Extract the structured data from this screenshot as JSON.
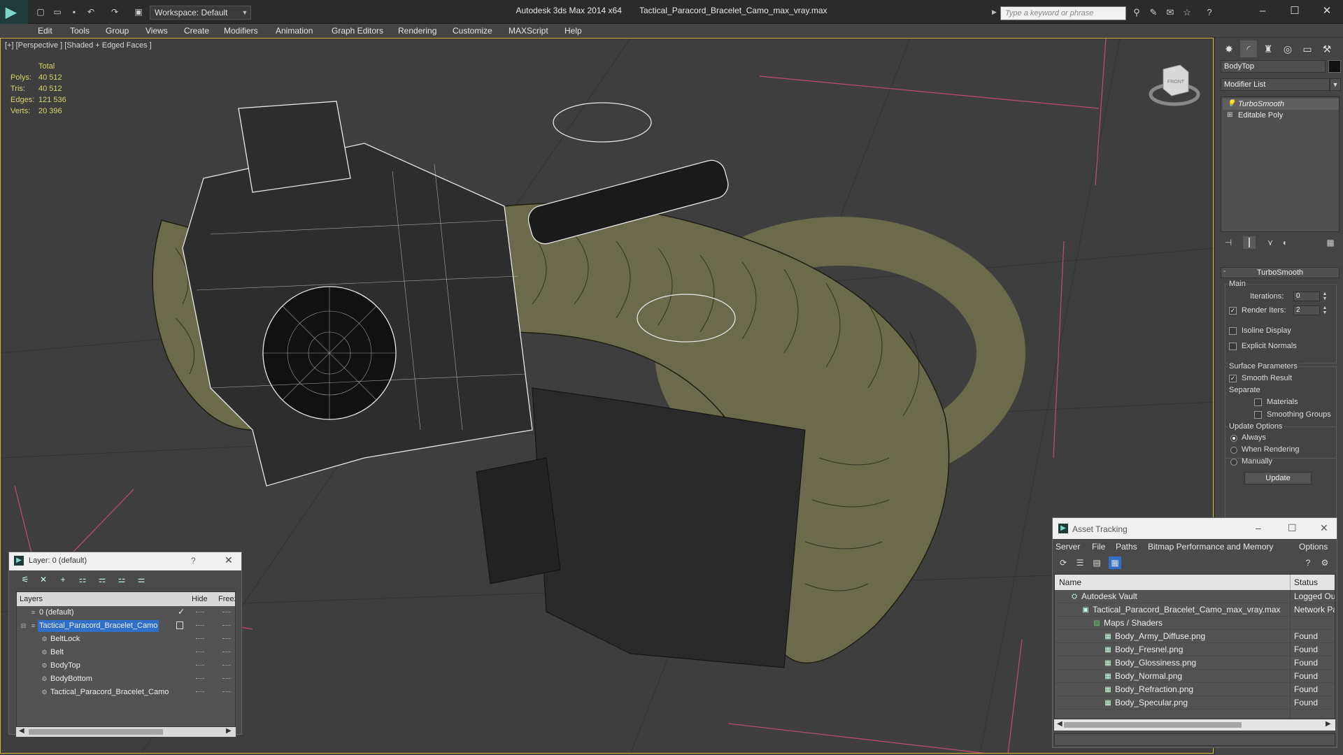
{
  "titlebar": {
    "workspace": "Workspace: Default",
    "app_name": "Autodesk 3ds Max  2014 x64",
    "file_name": "Tactical_Paracord_Bracelet_Camo_max_vray.max",
    "search_placeholder": "Type a keyword or phrase"
  },
  "menu": [
    "Edit",
    "Tools",
    "Group",
    "Views",
    "Create",
    "Modifiers",
    "Animation",
    "Graph Editors",
    "Rendering",
    "Customize",
    "MAXScript",
    "Help"
  ],
  "viewport": {
    "label": "[+] [Perspective ] [Shaded + Edged Faces ]",
    "stats": {
      "header": "Total",
      "rows": [
        {
          "key": "Polys:",
          "value": "40 512"
        },
        {
          "key": "Tris:",
          "value": "40 512"
        },
        {
          "key": "Edges:",
          "value": "121 536"
        },
        {
          "key": "Verts:",
          "value": "20 396"
        }
      ]
    },
    "viewcube_label": "FRONT"
  },
  "command_panel": {
    "object_name": "BodyTop",
    "modifier_list": "Modifier List",
    "stack": [
      "TurboSmooth",
      "Editable Poly"
    ],
    "rollout_title": "TurboSmooth",
    "main": {
      "label": "Main",
      "iterations_label": "Iterations:",
      "iterations_value": "0",
      "render_iters_label": "Render Iters:",
      "render_iters_value": "2",
      "render_iters_checked": true,
      "isoline_label": "Isoline Display",
      "explicit_label": "Explicit Normals"
    },
    "surface": {
      "label": "Surface Parameters",
      "smooth_result": "Smooth Result",
      "separate": "Separate",
      "materials": "Materials",
      "smoothing_groups": "Smoothing Groups"
    },
    "update": {
      "label": "Update Options",
      "always": "Always",
      "when_rendering": "When Rendering",
      "manually": "Manually",
      "button": "Update"
    }
  },
  "layer_window": {
    "title": "Layer: 0 (default)",
    "help": "?",
    "columns": {
      "layers": "Layers",
      "hide": "Hide",
      "freeze": "Freeze"
    },
    "rows": [
      {
        "name": "0 (default)",
        "level": 0,
        "active": true
      },
      {
        "name": "Tactical_Paracord_Bracelet_Camo",
        "level": 0,
        "selected": true
      },
      {
        "name": "BeltLock",
        "level": 1
      },
      {
        "name": "Belt",
        "level": 1
      },
      {
        "name": "BodyTop",
        "level": 1
      },
      {
        "name": "BodyBottom",
        "level": 1
      },
      {
        "name": "Tactical_Paracord_Bracelet_Camo",
        "level": 1
      }
    ]
  },
  "asset_window": {
    "title": "Asset Tracking",
    "menu": [
      "Server",
      "File",
      "Paths",
      "Bitmap Performance and Memory",
      "Options"
    ],
    "columns": {
      "name": "Name",
      "status": "Status"
    },
    "rows": [
      {
        "name": "Autodesk Vault",
        "status": "Logged Out",
        "level": 1
      },
      {
        "name": "Tactical_Paracord_Bracelet_Camo_max_vray.max",
        "status": "Network Path",
        "level": 2
      },
      {
        "name": "Maps / Shaders",
        "status": "",
        "level": 3
      },
      {
        "name": "Body_Army_Diffuse.png",
        "status": "Found",
        "level": 4
      },
      {
        "name": "Body_Fresnel.png",
        "status": "Found",
        "level": 4
      },
      {
        "name": "Body_Glossiness.png",
        "status": "Found",
        "level": 4
      },
      {
        "name": "Body_Normal.png",
        "status": "Found",
        "level": 4
      },
      {
        "name": "Body_Refraction.png",
        "status": "Found",
        "level": 4
      },
      {
        "name": "Body_Specular.png",
        "status": "Found",
        "level": 4
      }
    ]
  },
  "colors": {
    "selection_blue": "#2f6fc8",
    "viewport_bg": "#3e3e3e",
    "stats_yellow": "#d9d66a",
    "grid_pink": "#c04a7a"
  }
}
